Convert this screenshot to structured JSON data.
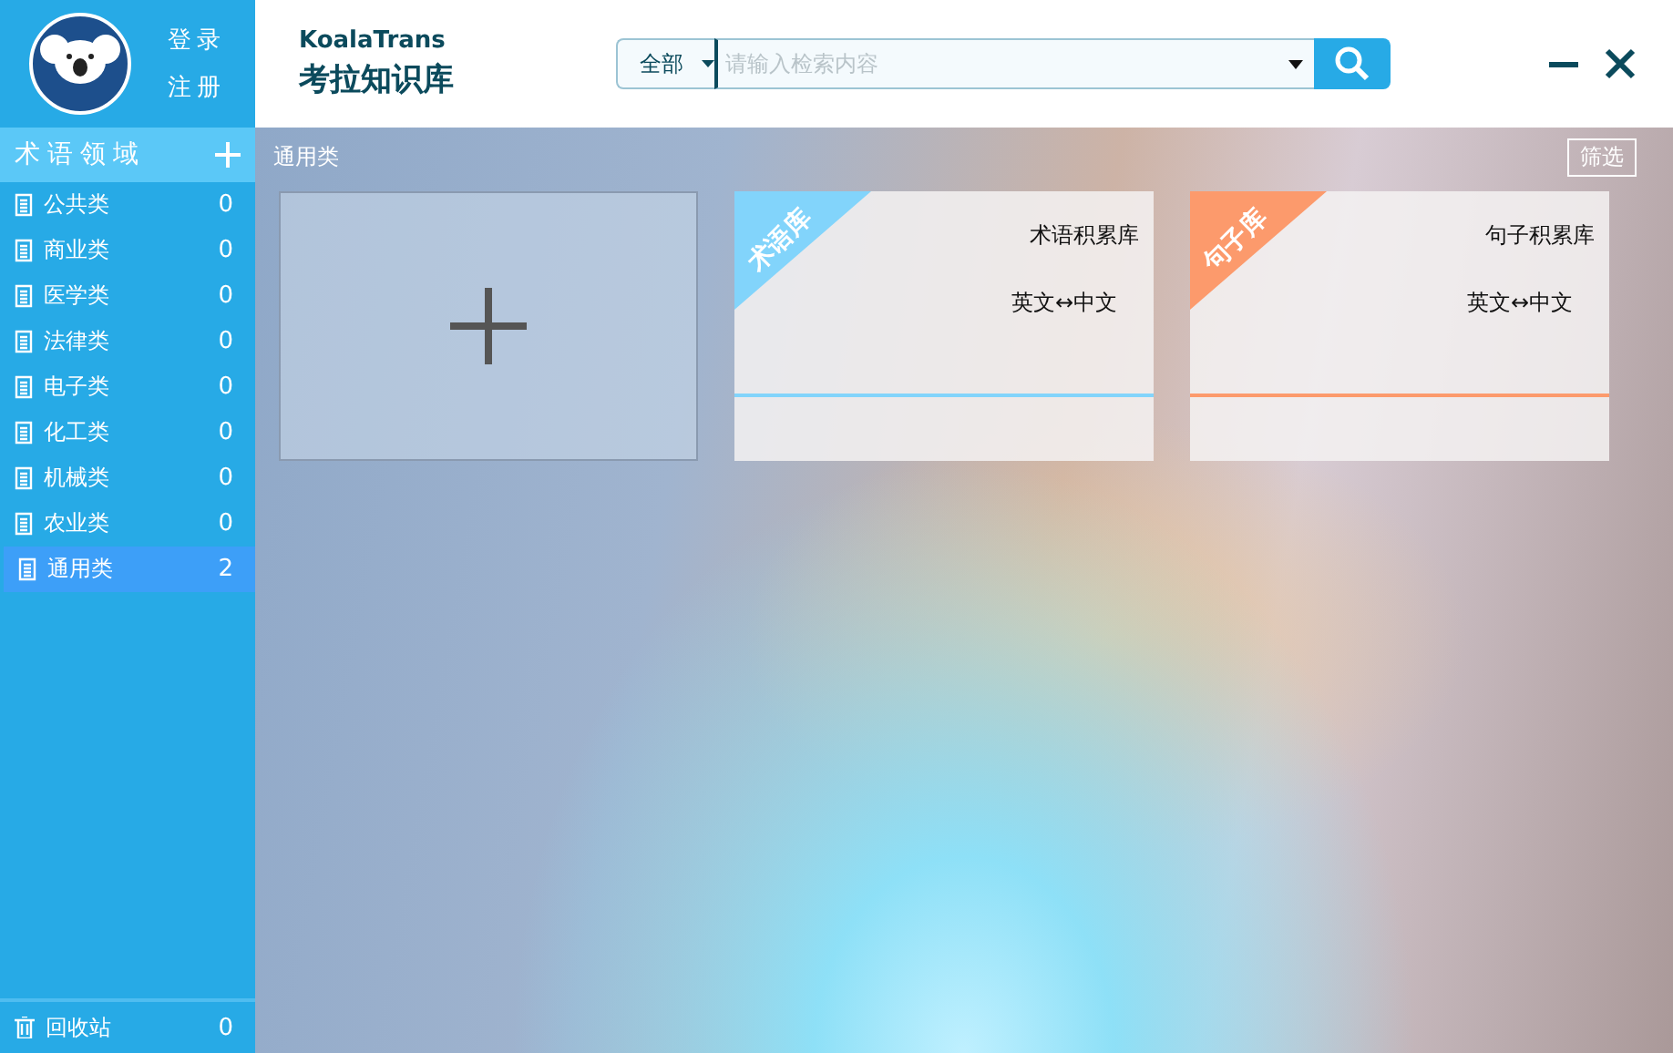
{
  "header": {
    "login": "登录",
    "register": "注册",
    "brand": "KoalaTrans",
    "title": "考拉知识库"
  },
  "search": {
    "scope": "全部",
    "placeholder": "请输入检索内容"
  },
  "sidebar": {
    "heading": "术语领域",
    "items": [
      {
        "label": "公共类",
        "count": "0",
        "selected": false
      },
      {
        "label": "商业类",
        "count": "0",
        "selected": false
      },
      {
        "label": "医学类",
        "count": "0",
        "selected": false
      },
      {
        "label": "法律类",
        "count": "0",
        "selected": false
      },
      {
        "label": "电子类",
        "count": "0",
        "selected": false
      },
      {
        "label": "化工类",
        "count": "0",
        "selected": false
      },
      {
        "label": "机械类",
        "count": "0",
        "selected": false
      },
      {
        "label": "农业类",
        "count": "0",
        "selected": false
      },
      {
        "label": "通用类",
        "count": "2",
        "selected": true
      }
    ],
    "trash": {
      "label": "回收站",
      "count": "0"
    }
  },
  "content": {
    "category": "通用类",
    "filter": "筛选",
    "cards": [
      {
        "ribbon": "术语库",
        "name": "术语积累库",
        "languages": "英文↔中文",
        "color": "#82d4fb"
      },
      {
        "ribbon": "句子库",
        "name": "句子积累库",
        "languages": "英文↔中文",
        "color": "#fc9a6c"
      }
    ]
  }
}
